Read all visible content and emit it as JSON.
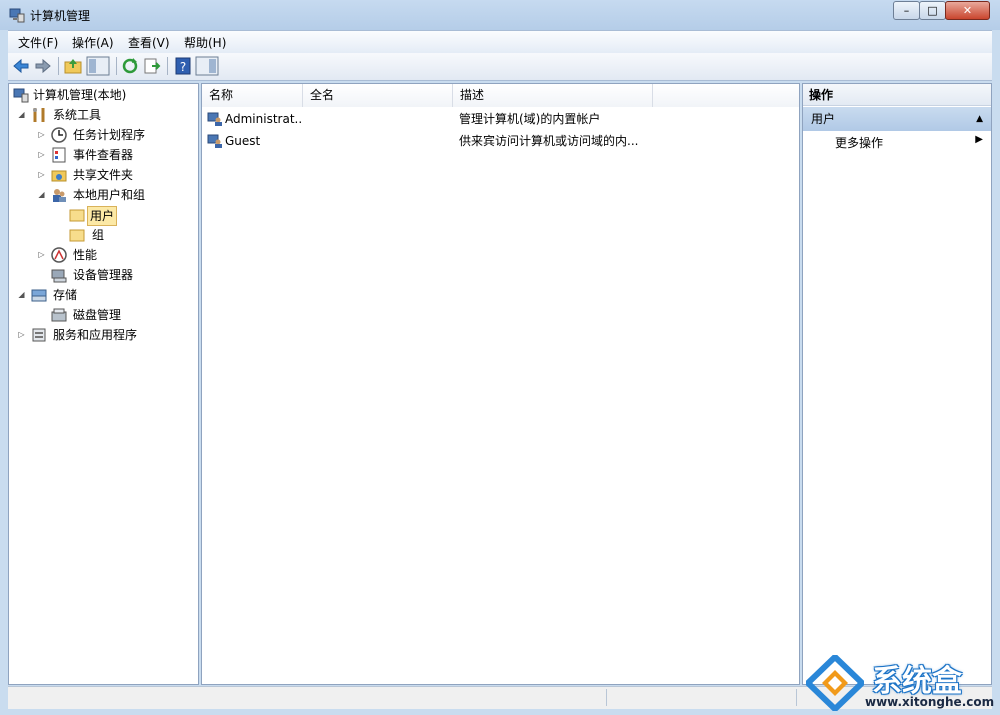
{
  "window": {
    "title": "计算机管理",
    "close_label": "✕",
    "min_label": "–",
    "max_label": "□"
  },
  "menu": [
    "文件(F)",
    "操作(A)",
    "查看(V)",
    "帮助(H)"
  ],
  "tree": [
    {
      "label": "计算机管理(本地)",
      "icon": "computer-management-icon",
      "twisty": ""
    },
    {
      "label": "系统工具",
      "icon": "system-tools-icon",
      "twisty": "◢"
    },
    {
      "label": "任务计划程序",
      "icon": "clock-icon",
      "twisty": "▷"
    },
    {
      "label": "事件查看器",
      "icon": "event-viewer-icon",
      "twisty": "▷"
    },
    {
      "label": "共享文件夹",
      "icon": "shared-folder-icon",
      "twisty": "▷"
    },
    {
      "label": "本地用户和组",
      "icon": "users-group-icon",
      "twisty": "◢"
    },
    {
      "label": "用户",
      "icon": "folder-icon",
      "twisty": ""
    },
    {
      "label": "组",
      "icon": "folder-icon",
      "twisty": ""
    },
    {
      "label": "性能",
      "icon": "performance-icon",
      "twisty": "▷"
    },
    {
      "label": "设备管理器",
      "icon": "device-manager-icon",
      "twisty": ""
    },
    {
      "label": "存储",
      "icon": "storage-icon",
      "twisty": "◢"
    },
    {
      "label": "磁盘管理",
      "icon": "disk-icon",
      "twisty": ""
    },
    {
      "label": "服务和应用程序",
      "icon": "services-icon",
      "twisty": "▷"
    }
  ],
  "list": {
    "columns": [
      "名称",
      "全名",
      "描述"
    ],
    "rows": [
      {
        "name": "Administrat...",
        "fullname": "",
        "desc": "管理计算机(域)的内置帐户"
      },
      {
        "name": "Guest",
        "fullname": "",
        "desc": "供来宾访问计算机或访问域的内..."
      }
    ]
  },
  "actions": {
    "title": "操作",
    "section": "用户",
    "more": "更多操作"
  },
  "watermark": {
    "name": "系统盒",
    "url": "www.xitonghe.com"
  },
  "colors": {
    "selection": "#fce9a6",
    "titlebar": "#c6daf0",
    "accent": "#1d74c7"
  }
}
